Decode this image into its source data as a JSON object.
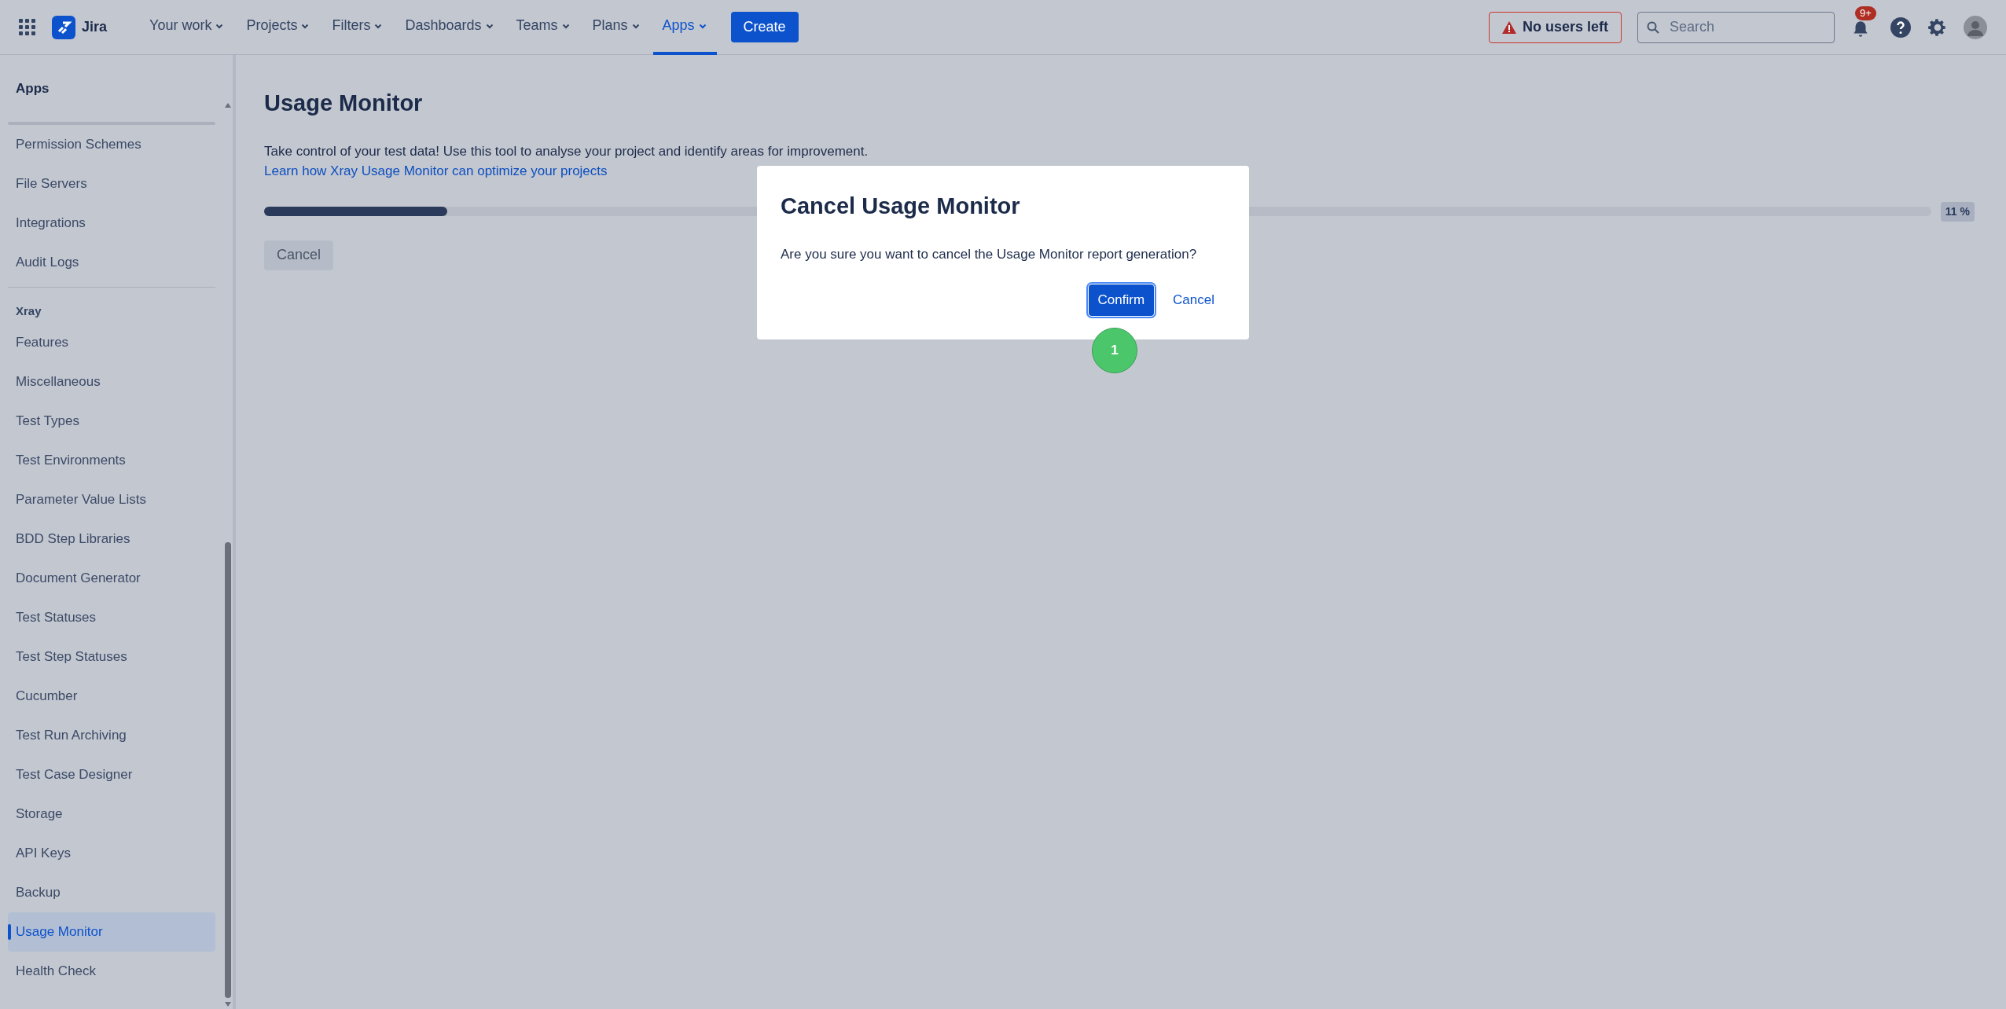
{
  "topbar": {
    "product": "Jira",
    "nav": [
      {
        "label": "Your work",
        "selected": false
      },
      {
        "label": "Projects",
        "selected": false
      },
      {
        "label": "Filters",
        "selected": false
      },
      {
        "label": "Dashboards",
        "selected": false
      },
      {
        "label": "Teams",
        "selected": false
      },
      {
        "label": "Plans",
        "selected": false
      },
      {
        "label": "Apps",
        "selected": true
      }
    ],
    "create": "Create",
    "license_warning": "No users left",
    "search": {
      "placeholder": "Search"
    },
    "notifications_badge": "9+"
  },
  "sidebar": {
    "title": "Apps",
    "groups": [
      {
        "items": [
          {
            "label": "Permission Schemes",
            "selected": false
          },
          {
            "label": "File Servers",
            "selected": false
          },
          {
            "label": "Integrations",
            "selected": false
          },
          {
            "label": "Audit Logs",
            "selected": false
          }
        ]
      },
      {
        "heading": "Xray",
        "items": [
          {
            "label": "Features",
            "selected": false
          },
          {
            "label": "Miscellaneous",
            "selected": false
          },
          {
            "label": "Test Types",
            "selected": false
          },
          {
            "label": "Test Environments",
            "selected": false
          },
          {
            "label": "Parameter Value Lists",
            "selected": false
          },
          {
            "label": "BDD Step Libraries",
            "selected": false
          },
          {
            "label": "Document Generator",
            "selected": false
          },
          {
            "label": "Test Statuses",
            "selected": false
          },
          {
            "label": "Test Step Statuses",
            "selected": false
          },
          {
            "label": "Cucumber",
            "selected": false
          },
          {
            "label": "Test Run Archiving",
            "selected": false
          },
          {
            "label": "Test Case Designer",
            "selected": false
          },
          {
            "label": "Storage",
            "selected": false
          },
          {
            "label": "API Keys",
            "selected": false
          },
          {
            "label": "Backup",
            "selected": false
          },
          {
            "label": "Usage Monitor",
            "selected": true
          },
          {
            "label": "Health Check",
            "selected": false
          }
        ]
      }
    ]
  },
  "main": {
    "title": "Usage Monitor",
    "description": "Take control of your test data! Use this tool to analyse your project and identify areas for improvement.",
    "link": "Learn how Xray Usage Monitor can optimize your projects",
    "progress": {
      "level": 0.11,
      "reading": "11 %"
    },
    "cancel": "Cancel"
  },
  "dialog": {
    "title": "Cancel Usage Monitor",
    "message": "Are you sure you want to cancel the Usage Monitor report generation?",
    "confirm": "Confirm",
    "cancel": "Cancel"
  },
  "step_marker": "1"
}
